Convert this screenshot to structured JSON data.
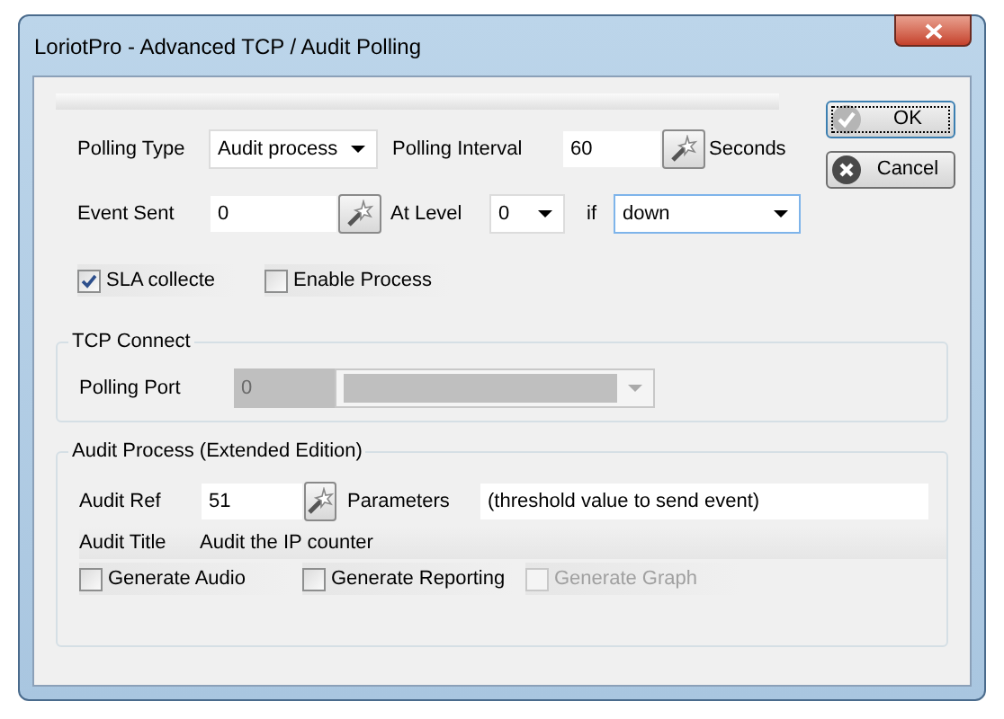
{
  "window": {
    "title": "LoriotPro - Advanced TCP / Audit Polling"
  },
  "buttons": [
    {
      "label": "OK",
      "kind": "ok",
      "focused": true
    },
    {
      "label": "Cancel",
      "kind": "cancel",
      "focused": false
    }
  ],
  "polling_type": {
    "label": "Polling Type",
    "value": "Audit process"
  },
  "polling_interval": {
    "label": "Polling Interval",
    "value": "60",
    "unit": "Seconds"
  },
  "event_sent": {
    "label": "Event Sent",
    "value": "0"
  },
  "at_level": {
    "label": "At Level",
    "value": "0"
  },
  "condition": {
    "label": "if",
    "value": "down"
  },
  "options": [
    {
      "label": "SLA collecte",
      "checked": true
    },
    {
      "label": "Enable Process",
      "checked": false
    }
  ],
  "tcp_connect": {
    "title": "TCP Connect",
    "polling_port": {
      "label": "Polling Port",
      "value": "0",
      "disabled": true
    }
  },
  "audit_process": {
    "title": "Audit Process (Extended Edition)",
    "audit_ref": {
      "label": "Audit Ref",
      "value": "51"
    },
    "parameters": {
      "label": "Parameters",
      "value": "(threshold value to send event)"
    },
    "audit_title": {
      "label": "Audit Title",
      "value": "Audit the IP counter"
    },
    "options": [
      {
        "label": "Generate Audio",
        "checked": false,
        "disabled": false
      },
      {
        "label": "Generate Reporting",
        "checked": false,
        "disabled": false
      },
      {
        "label": "Generate Graph",
        "checked": false,
        "disabled": true
      }
    ]
  }
}
